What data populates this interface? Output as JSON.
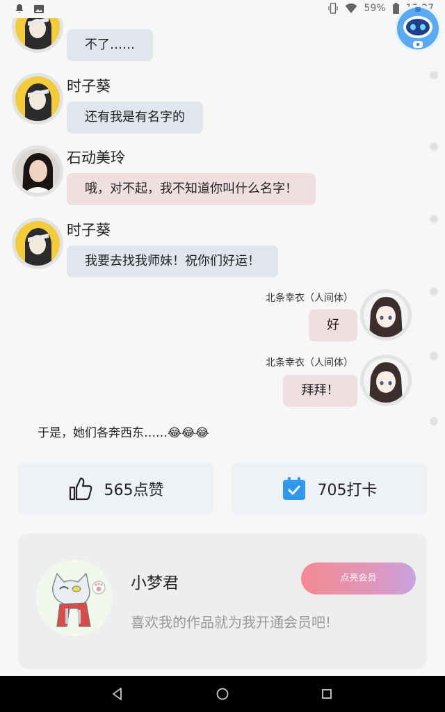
{
  "status_bar": {
    "battery": "59%",
    "time": "13:27",
    "icons": [
      "notification-bell-icon",
      "image-icon",
      "vibrate-icon",
      "wifi-icon",
      "battery-icon"
    ]
  },
  "messages": [
    {
      "side": "left",
      "name": "",
      "text": "不了……",
      "tone": "gray",
      "avatar": "yellow-character-avatar"
    },
    {
      "side": "left",
      "name": "时子葵",
      "text": "还有我是有名字的",
      "tone": "gray",
      "avatar": "yellow-character-avatar"
    },
    {
      "side": "left",
      "name": "石动美玲",
      "text": "哦，对不起，我不知道你叫什么名字！",
      "tone": "pink",
      "avatar": "woman-photo-avatar"
    },
    {
      "side": "left",
      "name": "时子葵",
      "text": "我要去找我师妹！祝你们好运！",
      "tone": "gray",
      "avatar": "yellow-character-avatar"
    },
    {
      "side": "right",
      "name": "北条幸衣（人间体）",
      "text": "好",
      "tone": "pink",
      "avatar": "anime-girl-avatar"
    },
    {
      "side": "right",
      "name": "北条幸衣（人间体）",
      "text": "拜拜！",
      "tone": "pink",
      "avatar": "anime-girl-avatar"
    }
  ],
  "narration": "于是，她们各奔西东……😂😂😂",
  "actions": {
    "like_label": "565点赞",
    "checkin_label": "705打卡"
  },
  "member": {
    "name": "小梦君",
    "slogan": "喜欢我的作品就为我开通会员吧!",
    "button_label": "点亮会员"
  },
  "colors": {
    "bubble_gray": "#e1e6ee",
    "bubble_pink": "#f0dfe1",
    "checkin_blue": "#2f97ee",
    "member_gradient_start": "#f48a91",
    "member_gradient_end": "#c8a2e0"
  }
}
